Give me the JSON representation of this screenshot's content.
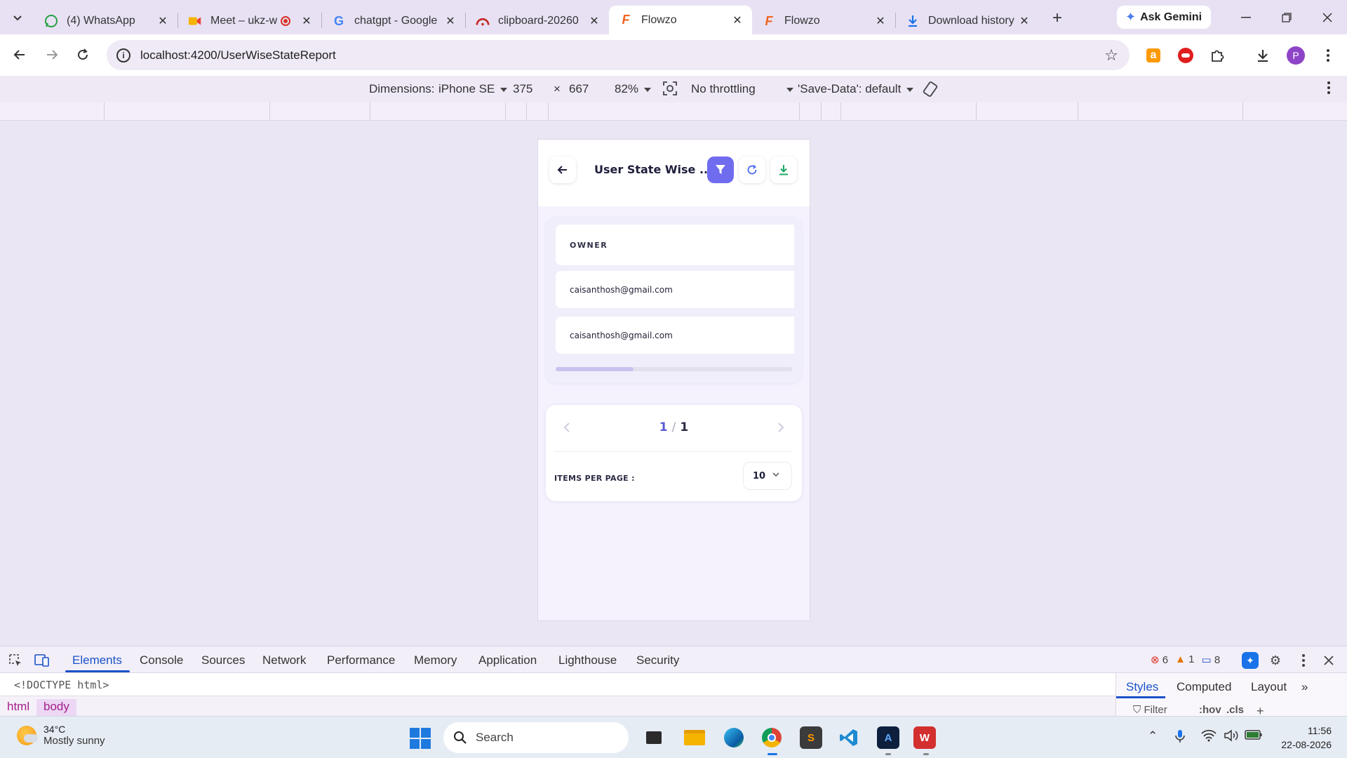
{
  "browser": {
    "tabs": [
      {
        "title": "(4) WhatsApp",
        "icon": "whatsapp-icon",
        "active": false
      },
      {
        "title": "Meet – ukz-w",
        "icon": "meet-icon",
        "active": false,
        "recording": true
      },
      {
        "title": "chatgpt - Google",
        "icon": "google-icon",
        "active": false
      },
      {
        "title": "clipboard-20260",
        "icon": "clipboard-icon",
        "active": false
      },
      {
        "title": "Flowzo",
        "icon": "flowzo-icon",
        "active": true
      },
      {
        "title": "Flowzo",
        "icon": "flowzo-icon",
        "active": false
      },
      {
        "title": "Download history",
        "icon": "download-icon",
        "active": false
      }
    ],
    "ask_gemini": "Ask Gemini",
    "url": "localhost:4200/UserWiseStateReport",
    "profile_initial": "P"
  },
  "device_toolbar": {
    "dimensions_label": "Dimensions:",
    "device": "iPhone SE",
    "width": "375",
    "times": "×",
    "height": "667",
    "zoom": "82%",
    "throttling": "No throttling",
    "save_data": "'Save-Data': default"
  },
  "app": {
    "title": "User State Wise ...",
    "table": {
      "header": "OWNER",
      "rows": [
        "caisanthosh@gmail.com",
        "caisanthosh@gmail.com"
      ],
      "scroll_fraction": 0.33
    },
    "pager": {
      "current": "1",
      "separator": "/",
      "total": "1",
      "items_per_page_label": "ITEMS PER PAGE :",
      "items_per_page": "10"
    },
    "colors": {
      "accent": "#6f6cf0",
      "download": "#1aa865",
      "refresh": "#4a6cf0"
    }
  },
  "devtools": {
    "tabs": [
      "Elements",
      "Console",
      "Sources",
      "Network",
      "Performance",
      "Memory",
      "Application",
      "Lighthouse",
      "Security"
    ],
    "active_tab": "Elements",
    "errors": "6",
    "warnings": "1",
    "messages": "8",
    "dom_line": "<!DOCTYPE html>",
    "breadcrumbs": [
      "html",
      "body"
    ],
    "side_tabs": [
      "Styles",
      "Computed",
      "Layout"
    ],
    "filter_placeholder": "Filter",
    "hov": ":hov",
    "cls": ".cls"
  },
  "taskbar": {
    "temperature": "34°C",
    "weather": "Mostly sunny",
    "search": "Search",
    "time": "11:56",
    "date": "22-08-2026"
  }
}
